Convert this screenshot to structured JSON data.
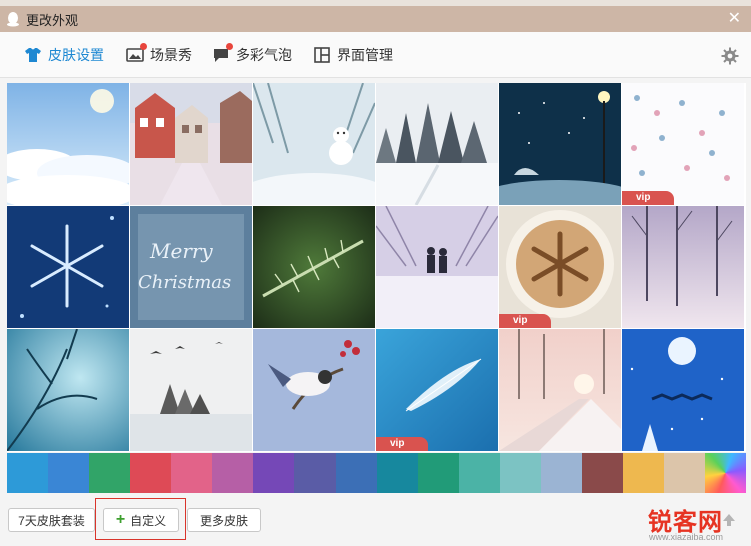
{
  "window": {
    "title": "更改外观",
    "close_symbol": "✕"
  },
  "tabs": [
    {
      "label": "皮肤设置",
      "icon": "shirt-icon",
      "active": true
    },
    {
      "label": "场景秀",
      "icon": "picture-icon",
      "badge": true
    },
    {
      "label": "多彩气泡",
      "icon": "chat-bubble-icon",
      "badge": true
    },
    {
      "label": "界面管理",
      "icon": "layout-icon"
    }
  ],
  "skins": [
    {
      "theme": "sky clouds",
      "vip": false
    },
    {
      "theme": "snowy street",
      "vip": false
    },
    {
      "theme": "snowman",
      "vip": false
    },
    {
      "theme": "snowy forest",
      "vip": false
    },
    {
      "theme": "night lamp umbrella",
      "vip": false
    },
    {
      "theme": "snowflake pattern",
      "vip": true
    },
    {
      "theme": "snowflake crystal",
      "vip": false
    },
    {
      "theme": "merry christmas window",
      "vip": false
    },
    {
      "theme": "pine branch",
      "vip": false
    },
    {
      "theme": "couple walking",
      "vip": false
    },
    {
      "theme": "coffee snowflake",
      "vip": true
    },
    {
      "theme": "misty trees",
      "vip": false
    },
    {
      "theme": "frozen branches",
      "vip": false
    },
    {
      "theme": "birds over lake",
      "vip": false
    },
    {
      "theme": "bird on branch",
      "vip": false
    },
    {
      "theme": "feather",
      "vip": true
    },
    {
      "theme": "sunset bridge",
      "vip": false
    },
    {
      "theme": "moon reindeer",
      "vip": false
    }
  ],
  "vip_label": "vip",
  "swatch_colors": [
    "#2d9ad8",
    "#3a86d5",
    "#31a468",
    "#de4a56",
    "#e26389",
    "#b65fa6",
    "#7548b7",
    "#5a5ca6",
    "#3c6fb6",
    "#17889e",
    "#219b78",
    "#4bb3a6",
    "#7cc3c3",
    "#9bb4d3",
    "#8a4a4a",
    "#eeb84f",
    "#dcc5aa",
    "rainbow"
  ],
  "buttons": {
    "package": "7天皮肤套装",
    "custom": "自定义",
    "more": "更多皮肤"
  },
  "watermark": {
    "brand": "锐客网",
    "url": "www.xiazaiba.com"
  },
  "colors": {
    "accent": "#1e88d2",
    "titlebar": "#cdb6a6",
    "highlight": "#d9342b",
    "vip": "#d9534f"
  }
}
